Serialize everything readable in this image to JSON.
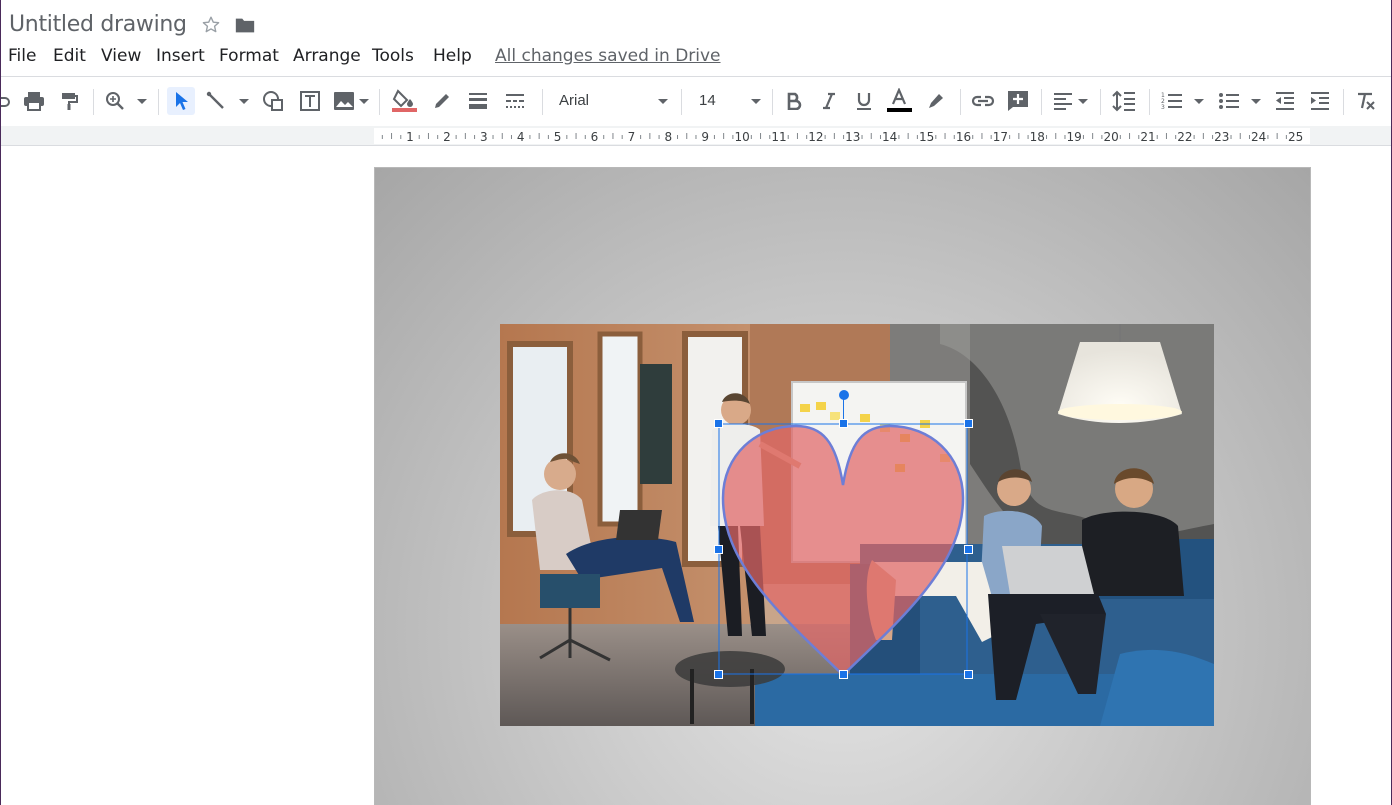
{
  "document": {
    "title": "Untitled drawing"
  },
  "menu": {
    "items": [
      "File",
      "Edit",
      "View",
      "Insert",
      "Format",
      "Arrange",
      "Tools",
      "Help"
    ],
    "save_status": "All changes saved in Drive"
  },
  "toolbar": {
    "font_name": "Arial",
    "font_size": "14",
    "icons": [
      "undo-icon",
      "print-icon",
      "paint-format-icon",
      "zoom-icon",
      "select-icon",
      "line-icon",
      "shape-icon",
      "textbox-icon",
      "image-icon",
      "fill-color-icon",
      "border-color-icon",
      "border-weight-icon",
      "border-dash-icon",
      "bold-icon",
      "italic-icon",
      "underline-icon",
      "text-color-icon",
      "highlight-icon",
      "link-icon",
      "comment-icon",
      "align-icon",
      "line-spacing-icon",
      "numbered-list-icon",
      "bulleted-list-icon",
      "decrease-indent-icon",
      "increase-indent-icon",
      "clear-formatting-icon"
    ],
    "fill_color": "#e06666",
    "text_color": "#000000"
  },
  "ruler": {
    "marks": [
      "1",
      "2",
      "3",
      "4",
      "5",
      "6",
      "7",
      "8",
      "9",
      "10",
      "11",
      "12",
      "13",
      "14",
      "15",
      "16",
      "17",
      "18",
      "19",
      "20",
      "21",
      "22",
      "23",
      "24",
      "25"
    ]
  },
  "canvas": {
    "selected_shape": "heart",
    "selected_shape_fill": "#e06666",
    "selection_color": "#1a73e8"
  }
}
